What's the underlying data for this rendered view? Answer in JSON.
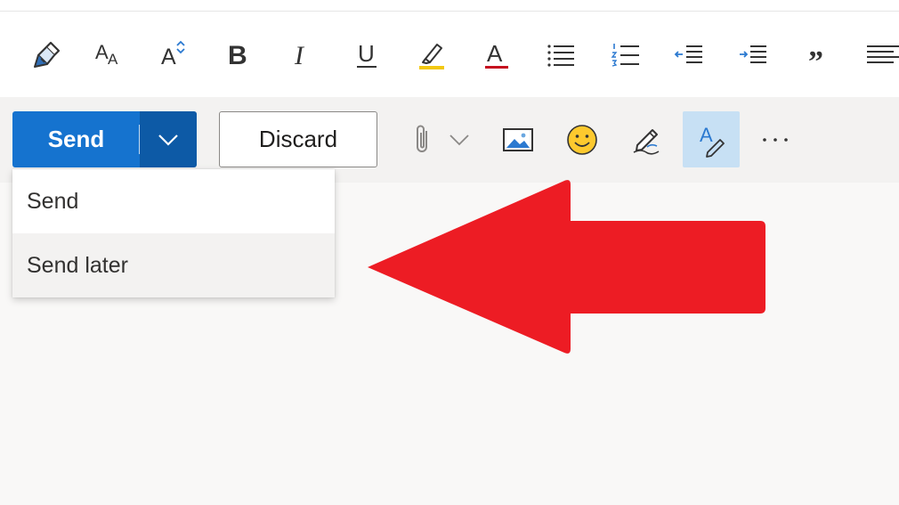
{
  "format_toolbar": {
    "tools": [
      {
        "icon": "format-painter-icon"
      },
      {
        "icon": "font-size-icon",
        "glyph": "AA"
      },
      {
        "icon": "grow-font-icon",
        "glyph": "A"
      },
      {
        "icon": "bold-icon",
        "glyph": "B"
      },
      {
        "icon": "italic-icon",
        "glyph": "I"
      },
      {
        "icon": "underline-icon",
        "glyph": "U"
      },
      {
        "icon": "highlight-icon",
        "color": "#f2c811"
      },
      {
        "icon": "font-color-icon",
        "glyph": "A",
        "color": "#c50f1f"
      },
      {
        "icon": "bullet-list-icon"
      },
      {
        "icon": "numbered-list-icon"
      },
      {
        "icon": "decrease-indent-icon"
      },
      {
        "icon": "increase-indent-icon"
      },
      {
        "icon": "quote-icon",
        "glyph": "”"
      },
      {
        "icon": "align-left-icon"
      }
    ]
  },
  "action_bar": {
    "send_label": "Send",
    "discard_label": "Discard",
    "send_button_color": "#1573cf",
    "send_chevron_color": "#0d5aa6",
    "icons": [
      "attach-icon",
      "chevron-down-icon",
      "insert-picture-icon",
      "emoji-icon",
      "signature-icon",
      "editor-icon",
      "more-options-icon"
    ]
  },
  "send_menu": {
    "items": [
      {
        "label": "Send"
      },
      {
        "label": "Send later",
        "highlighted": true
      }
    ]
  },
  "annotation": {
    "color": "#ed1c24",
    "icon": "red-arrow-icon"
  }
}
